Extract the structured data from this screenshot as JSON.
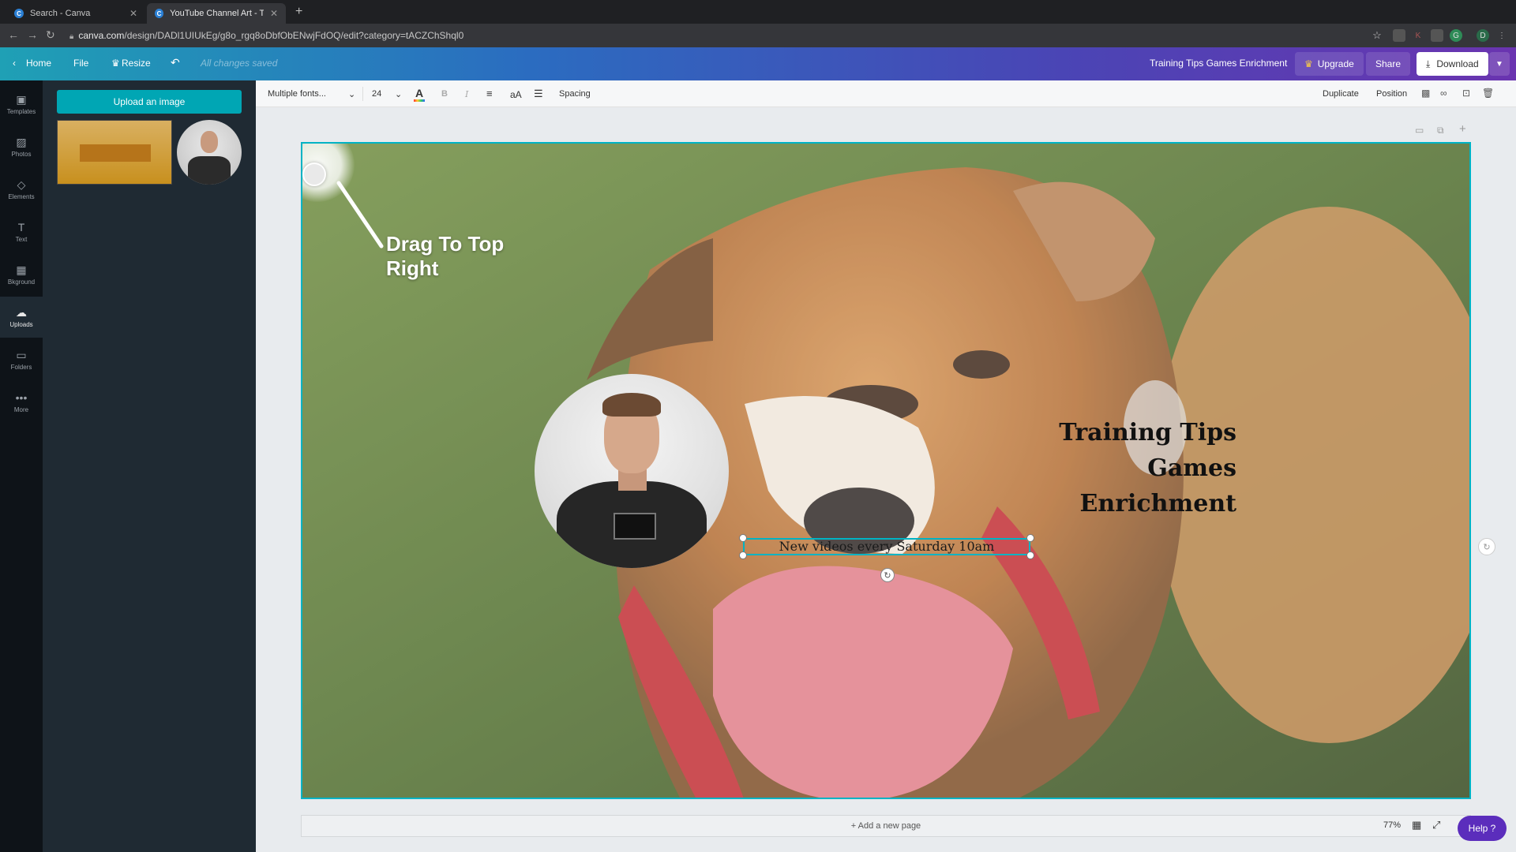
{
  "browser": {
    "tabs": [
      {
        "title": "Search - Canva",
        "favicon": "C"
      },
      {
        "title": "YouTube Channel Art - Trainin...",
        "favicon": "C"
      }
    ],
    "url_host": "canva.com",
    "url_path": "/design/DADl1UIUkEg/g8o_rgq8oDbfObENwjFdOQ/edit?category=tACZChShql0"
  },
  "header": {
    "home": "Home",
    "file": "File",
    "resize": "Resize",
    "saved_status": "All changes saved",
    "design_title": "Training Tips Games Enrichment",
    "upgrade": "Upgrade",
    "share": "Share",
    "download": "Download"
  },
  "rail": [
    {
      "label": "Templates",
      "icon": "templates-icon",
      "glyph": "▣"
    },
    {
      "label": "Photos",
      "icon": "photos-icon",
      "glyph": "▨"
    },
    {
      "label": "Elements",
      "icon": "elements-icon",
      "glyph": "◇"
    },
    {
      "label": "Text",
      "icon": "text-icon",
      "glyph": "T"
    },
    {
      "label": "Bkground",
      "icon": "background-icon",
      "glyph": "▦"
    },
    {
      "label": "Uploads",
      "icon": "uploads-icon",
      "glyph": "☁"
    },
    {
      "label": "Folders",
      "icon": "folders-icon",
      "glyph": "▭"
    },
    {
      "label": "More",
      "icon": "more-icon",
      "glyph": "•••"
    }
  ],
  "panel": {
    "upload_button": "Upload an image"
  },
  "toolbar": {
    "font": "Multiple fonts...",
    "font_size": "24",
    "bold": "B",
    "italic": "I",
    "case": "aA",
    "spacing": "Spacing",
    "duplicate": "Duplicate",
    "position": "Position"
  },
  "canvas": {
    "headline": [
      "Training Tips",
      "Games",
      "Enrichment"
    ],
    "subtitle": "New videos every Saturday 10am",
    "tutorial_hint": "Drag To Top Right"
  },
  "bottom": {
    "add_page": "+ Add a new page",
    "zoom": "77%",
    "help": "Help ?"
  },
  "colors": {
    "accent": "#00b3c4",
    "upload_button": "#00a6b4",
    "help_button": "#5b2dbc"
  }
}
